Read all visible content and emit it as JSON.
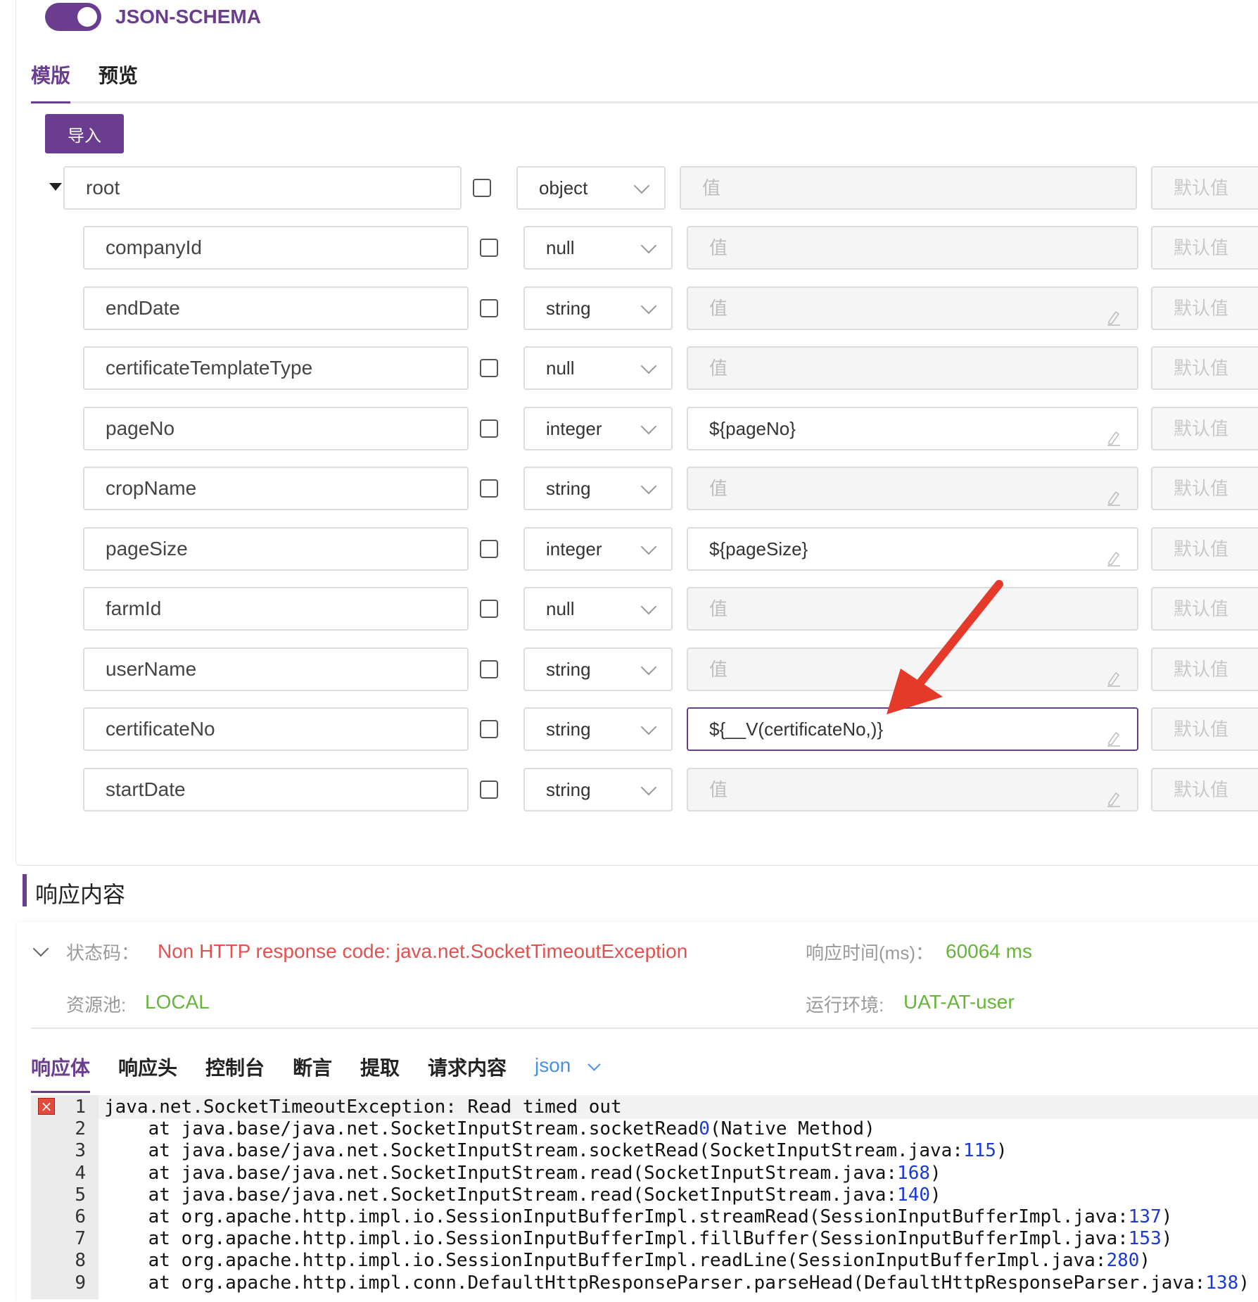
{
  "schema": {
    "toggle_label": "JSON-SCHEMA",
    "tabs": [
      {
        "label": "模版"
      },
      {
        "label": "预览"
      }
    ],
    "import_label": "导入",
    "root": {
      "name": "root",
      "type": "object",
      "value_placeholder": "值",
      "default_placeholder": "默认值"
    },
    "fields": [
      {
        "name": "companyId",
        "type": "null",
        "value": "",
        "placeholder": "值",
        "default": "默认值"
      },
      {
        "name": "endDate",
        "type": "string",
        "value": "",
        "placeholder": "值",
        "default": "默认值"
      },
      {
        "name": "certificateTemplateType",
        "type": "null",
        "value": "",
        "placeholder": "值",
        "default": "默认值"
      },
      {
        "name": "pageNo",
        "type": "integer",
        "value": "${pageNo}",
        "placeholder": "值",
        "default": "默认值"
      },
      {
        "name": "cropName",
        "type": "string",
        "value": "",
        "placeholder": "值",
        "default": "默认值"
      },
      {
        "name": "pageSize",
        "type": "integer",
        "value": "${pageSize}",
        "placeholder": "值",
        "default": "默认值"
      },
      {
        "name": "farmId",
        "type": "null",
        "value": "",
        "placeholder": "值",
        "default": "默认值"
      },
      {
        "name": "userName",
        "type": "string",
        "value": "",
        "placeholder": "值",
        "default": "默认值"
      },
      {
        "name": "certificateNo",
        "type": "string",
        "value": "${__V(certificateNo,)}",
        "placeholder": "值",
        "default": "默认值"
      },
      {
        "name": "startDate",
        "type": "string",
        "value": "",
        "placeholder": "值",
        "default": "默认值"
      }
    ]
  },
  "response": {
    "section_title": "响应内容",
    "status_label": "状态码：",
    "status_value": "Non HTTP response code: java.net.SocketTimeoutException",
    "time_label": "响应时间(ms)：",
    "time_value": "60064 ms",
    "pool_label": "资源池:",
    "pool_value": "LOCAL",
    "env_label": "运行环境:",
    "env_value": "UAT-AT-user",
    "tabs": [
      {
        "label": "响应体"
      },
      {
        "label": "响应头"
      },
      {
        "label": "控制台"
      },
      {
        "label": "断言"
      },
      {
        "label": "提取"
      },
      {
        "label": "请求内容"
      }
    ],
    "format": "json",
    "lines": [
      {
        "n": "1",
        "text": "java.net.SocketTimeoutException: Read timed out",
        "num": "",
        "end": ""
      },
      {
        "n": "2",
        "text": "    at java.base/java.net.SocketInputStream.socketRead",
        "num": "0",
        "end": "(Native Method)"
      },
      {
        "n": "3",
        "text": "    at java.base/java.net.SocketInputStream.socketRead(SocketInputStream.java:",
        "num": "115",
        "end": ")"
      },
      {
        "n": "4",
        "text": "    at java.base/java.net.SocketInputStream.read(SocketInputStream.java:",
        "num": "168",
        "end": ")"
      },
      {
        "n": "5",
        "text": "    at java.base/java.net.SocketInputStream.read(SocketInputStream.java:",
        "num": "140",
        "end": ")"
      },
      {
        "n": "6",
        "text": "    at org.apache.http.impl.io.SessionInputBufferImpl.streamRead(SessionInputBufferImpl.java:",
        "num": "137",
        "end": ")"
      },
      {
        "n": "7",
        "text": "    at org.apache.http.impl.io.SessionInputBufferImpl.fillBuffer(SessionInputBufferImpl.java:",
        "num": "153",
        "end": ")"
      },
      {
        "n": "8",
        "text": "    at org.apache.http.impl.io.SessionInputBufferImpl.readLine(SessionInputBufferImpl.java:",
        "num": "280",
        "end": ")"
      },
      {
        "n": "9",
        "text": "    at org.apache.http.impl.conn.DefaultHttpResponseParser.parseHead(DefaultHttpResponseParser.java:",
        "num": "138",
        "end": ")"
      }
    ]
  }
}
